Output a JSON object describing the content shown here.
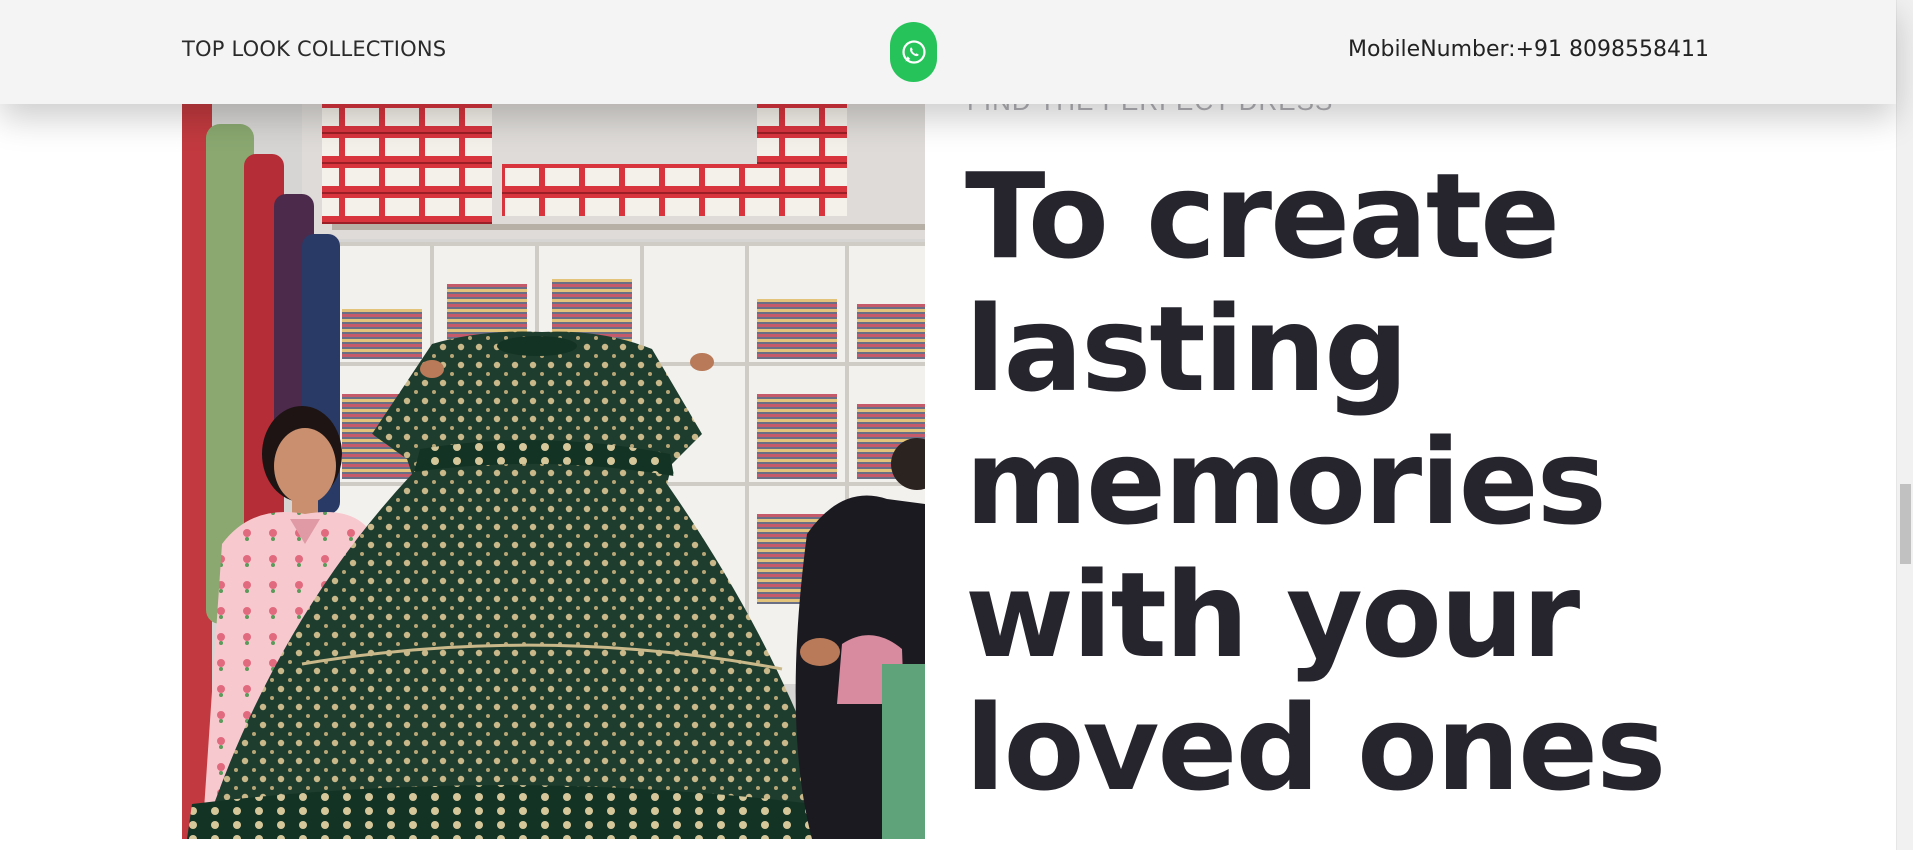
{
  "header": {
    "brand": "TOP LOOK COLLECTIONS",
    "whatsapp_icon": "whatsapp-icon",
    "phone": "MobileNumber:+91 8098558411"
  },
  "hero": {
    "kicker": "FIND THE PERFECT DRESS",
    "headline": "To create lasting memories with your loved ones",
    "image_alt": "Women in a clothing store holding up a long green printed dress"
  },
  "colors": {
    "header_bg": "#f4f4f4",
    "whatsapp_green": "#25c35a",
    "headline": "#26252e",
    "kicker": "#b1b1b6"
  }
}
